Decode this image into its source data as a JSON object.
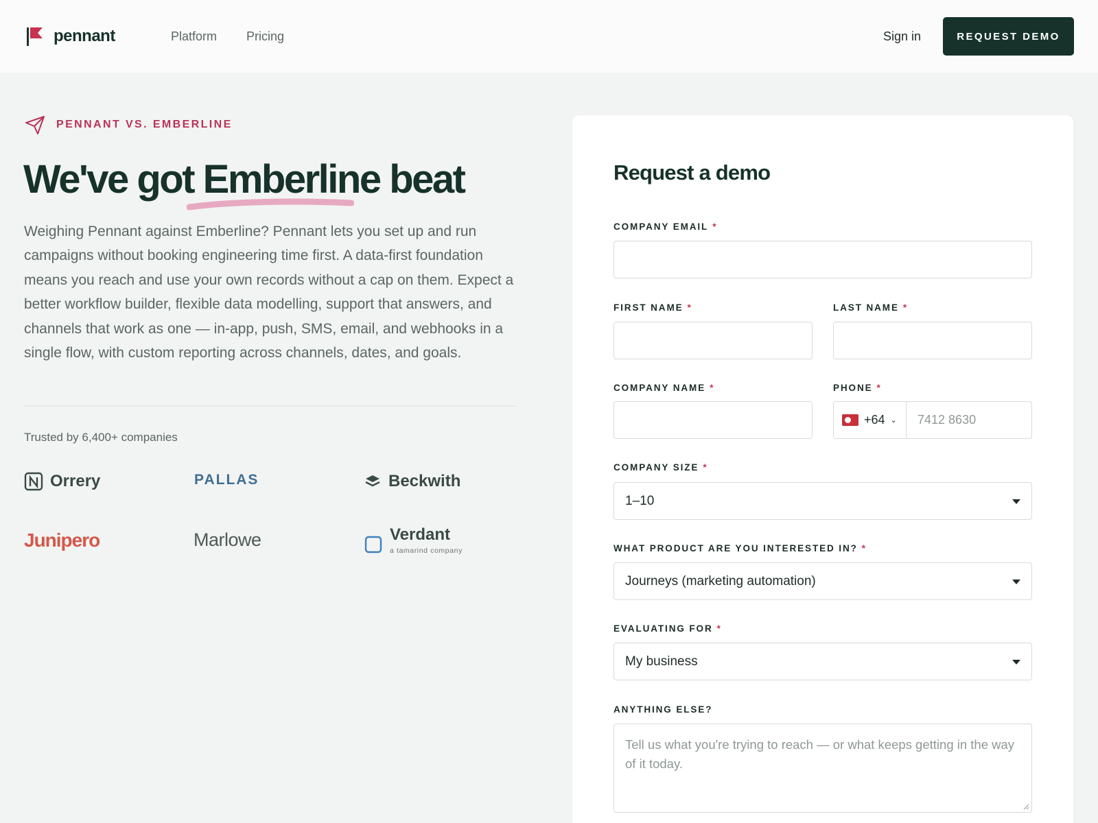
{
  "header": {
    "brand": "pennant",
    "nav": [
      "Platform",
      "Pricing"
    ],
    "signin": "Sign in",
    "cta": "REQUEST DEMO"
  },
  "hero": {
    "eyebrow": "PENNANT VS. EMBERLINE",
    "title": "We've got Emberline beat",
    "body": "Weighing Pennant against Emberline? Pennant lets you set up and run campaigns without booking engineering time first. A data-first foundation means you reach and use your own records without a cap on them. Expect a better workflow builder, flexible data modelling, support that answers, and channels that work as one — in-app, push, SMS, email, and webhooks in a single flow, with custom reporting across channels, dates, and goals."
  },
  "trusted": {
    "label": "Trusted by 6,400+ companies",
    "logos": {
      "orrery": "Orrery",
      "pallas": "PALLAS",
      "beckwith": "Beckwith",
      "junipero": "Junipero",
      "marlowe": "Marlowe",
      "verdant": "Verdant",
      "verdant_sub": "a tamarind company"
    }
  },
  "form": {
    "title": "Request a demo",
    "required_mark": "*",
    "email_label": "COMPANY EMAIL",
    "first_label": "FIRST NAME",
    "last_label": "LAST NAME",
    "company_label": "COMPANY NAME",
    "phone_label": "PHONE",
    "phone_code": "+64",
    "phone_placeholder": "7412 8630",
    "size_label": "COMPANY SIZE",
    "size_value": "1–10",
    "product_label": "WHAT PRODUCT ARE YOU INTERESTED IN?",
    "product_value": "Journeys (marketing automation)",
    "eval_label": "EVALUATING FOR",
    "eval_value": "My business",
    "anything_label": "ANYTHING ELSE?",
    "anything_placeholder": "Tell us what you're trying to reach — or what keeps getting in the way of it today."
  },
  "colors": {
    "brand_dark": "#16322a",
    "accent_pink": "#b8325a",
    "junipero": "#d4584a",
    "pallas": "#3f6f92"
  }
}
